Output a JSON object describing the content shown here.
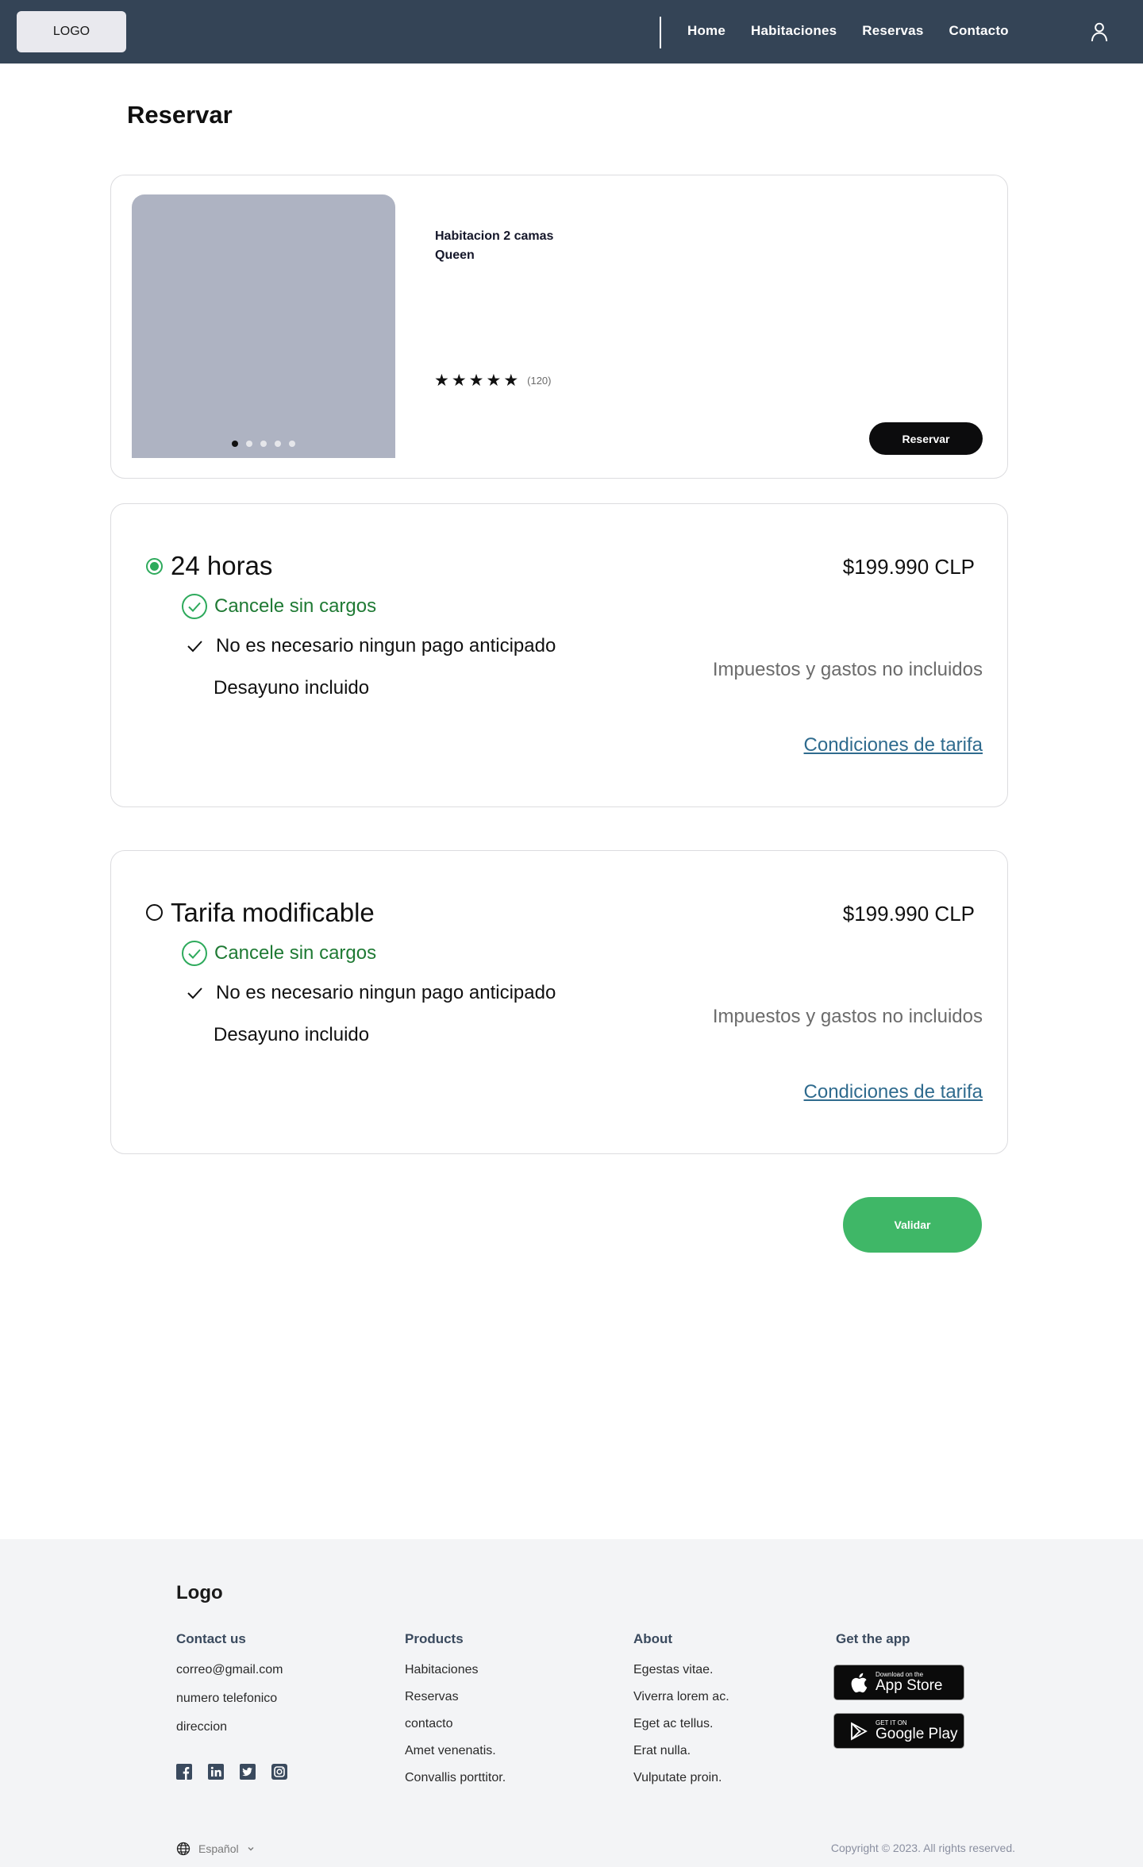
{
  "nav": {
    "logo": "LOGO",
    "links": [
      "Home",
      "Habitaciones",
      "Reservas",
      "Contacto"
    ],
    "user_icon": "user-icon",
    "bg_color": "#344456"
  },
  "page": {
    "title": "Reservar"
  },
  "room": {
    "name": "Habitacion 2 camas Queen",
    "rating_stars": 5,
    "reviews": "(120)",
    "reserve_label": "Reservar",
    "carousel_slides": 5,
    "carousel_active": 0
  },
  "rates": [
    {
      "title": "24 horas",
      "selected": true,
      "price": "$199.990 CLP",
      "cancel": "Cancele sin cargos",
      "prepay": "No es necesario ningun pago anticipado",
      "breakfast": "Desayuno incluido",
      "taxes": "Impuestos y gastos no incluidos",
      "conditions": "Condiciones de tarifa"
    },
    {
      "title": "Tarifa modificable",
      "selected": false,
      "price": "$199.990 CLP",
      "cancel": "Cancele sin cargos",
      "prepay": "No es necesario ningun pago anticipado",
      "breakfast": "Desayuno incluido",
      "taxes": "Impuestos y gastos no incluidos",
      "conditions": "Condiciones de tarifa"
    }
  ],
  "validate_label": "Validar",
  "footer": {
    "logo": "Logo",
    "contact": {
      "heading": "Contact us",
      "items": [
        "correo@gmail.com",
        "numero telefonico",
        "direccion"
      ]
    },
    "products": {
      "heading": "Products",
      "items": [
        "Habitaciones",
        "Reservas",
        "contacto",
        "Amet venenatis.",
        "Convallis porttitor."
      ]
    },
    "about": {
      "heading": "About",
      "items": [
        "Egestas vitae.",
        "Viverra lorem ac.",
        "Eget ac tellus.",
        "Erat nulla.",
        "Vulputate proin."
      ]
    },
    "app": {
      "heading": "Get the app",
      "appstore_small": "Download on the",
      "appstore_big": "App Store",
      "googleplay_small": "GET IT ON",
      "googleplay_big": "Google Play"
    },
    "socials": [
      "facebook-icon",
      "linkedin-icon",
      "twitter-icon",
      "instagram-icon"
    ],
    "language": "Español",
    "copyright": "Copyright © 2023. All rights reserved."
  },
  "colors": {
    "accent_green": "#3fb767",
    "text_green": "#1f7a34",
    "link_blue": "#2f6b8e"
  }
}
